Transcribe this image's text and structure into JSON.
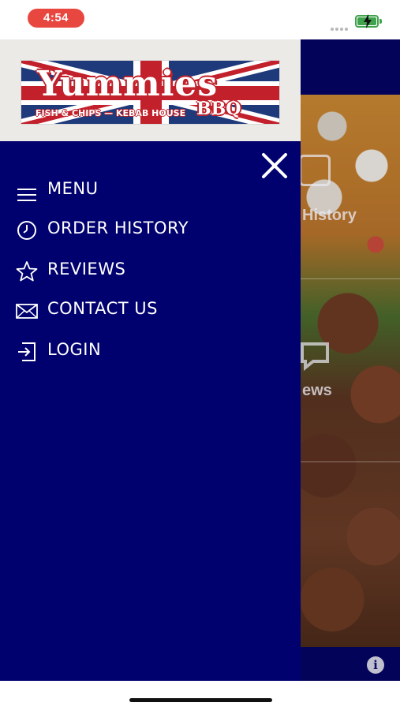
{
  "status_bar": {
    "time": "4:54",
    "battery_state": "charging",
    "accent_color": "#e8473f",
    "battery_color": "#3ea34a"
  },
  "logo": {
    "title": "Yummies",
    "badge": "BBQ",
    "subtitle": "FISH & CHIPS — KEBAB HOUSE"
  },
  "drawer": {
    "background_color": "#00006e",
    "close_icon": "close-icon",
    "items": [
      {
        "label": "MENU",
        "icon": "hamburger-icon"
      },
      {
        "label": "ORDER HISTORY",
        "icon": "clock-icon"
      },
      {
        "label": "REVIEWS",
        "icon": "star-icon"
      },
      {
        "label": "CONTACT US",
        "icon": "envelope-icon"
      },
      {
        "label": "LOGIN",
        "icon": "login-icon"
      }
    ]
  },
  "background_screen": {
    "tile_labels": [
      "History",
      "ews"
    ],
    "info_icon": "info-icon"
  }
}
